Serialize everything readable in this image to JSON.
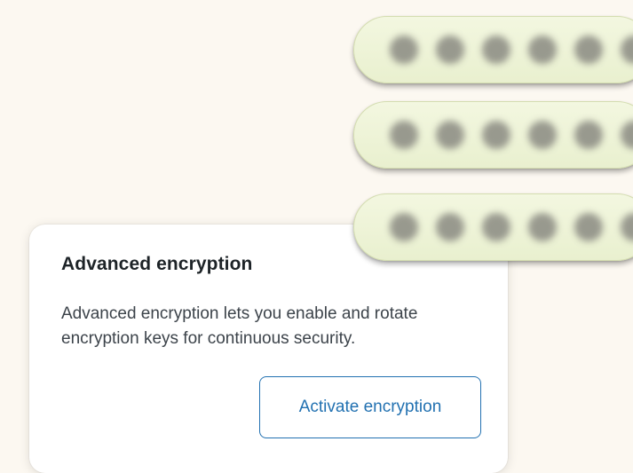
{
  "card": {
    "title": "Advanced encryption",
    "description": "Advanced encryption lets you enable and rotate encryption keys for continuous security.",
    "button_label": "Activate encryption"
  },
  "masked_keys": [
    {
      "state": "masked",
      "dot_count": 6
    },
    {
      "state": "masked",
      "dot_count": 6
    },
    {
      "state": "masked",
      "dot_count": 6
    }
  ],
  "colors": {
    "background": "#fcf8f1",
    "accent": "#2271b1",
    "pill": "#eef3d8"
  }
}
